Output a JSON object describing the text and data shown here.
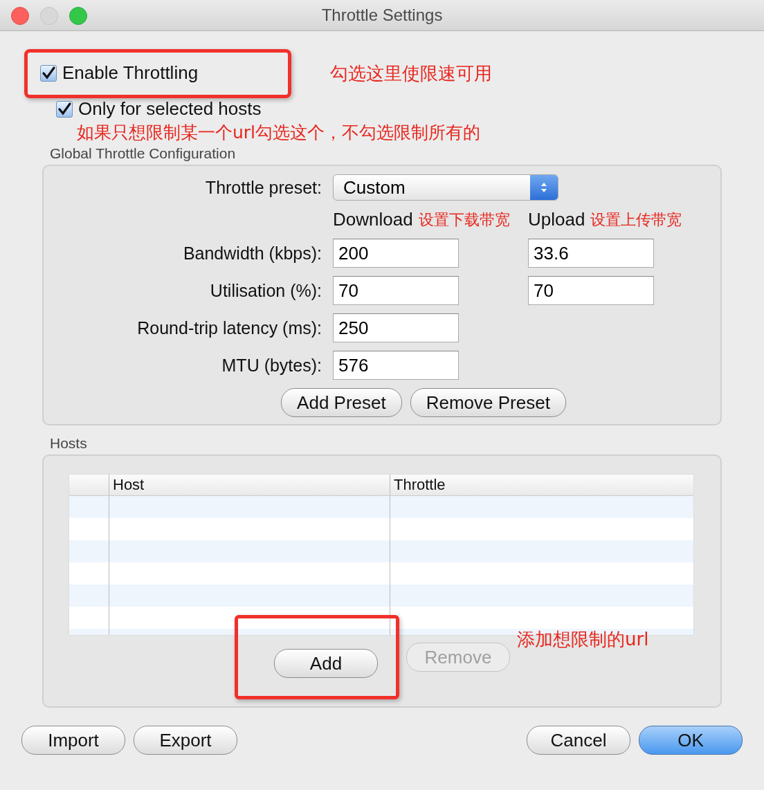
{
  "window": {
    "title": "Throttle Settings"
  },
  "enable_throttling": {
    "label": "Enable Throttling",
    "checked": true,
    "highlighted": true,
    "note": "勾选这里使限速可用"
  },
  "only_selected_hosts": {
    "label": "Only for selected hosts",
    "checked": true,
    "note": "如果只想限制某一个url勾选这个，不勾选限制所有的"
  },
  "global_config": {
    "title": "Global Throttle Configuration",
    "preset": {
      "label": "Throttle preset:",
      "value": "Custom"
    },
    "column_headers": [
      {
        "label": "Download",
        "note": "设置下载带宽"
      },
      {
        "label": "Upload",
        "note": "设置上传带宽"
      }
    ],
    "rows": [
      {
        "label": "Bandwidth (kbps):",
        "download": "200",
        "upload": "33.6"
      },
      {
        "label": "Utilisation (%):",
        "download": "70",
        "upload": "70"
      },
      {
        "label": "Round-trip latency (ms):",
        "download": "250"
      },
      {
        "label": "MTU (bytes):",
        "download": "576"
      }
    ],
    "buttons": [
      {
        "label": "Add Preset",
        "disabled": false
      },
      {
        "label": "Remove Preset",
        "disabled": false
      }
    ]
  },
  "hosts": {
    "title": "Hosts",
    "table": {
      "columns": [
        "Host",
        "Throttle"
      ]
    },
    "buttons": [
      {
        "label": "Add",
        "disabled": false,
        "highlighted": true
      },
      {
        "label": "Remove",
        "disabled": true,
        "highlighted": false
      }
    ],
    "note": "添加想限制的url"
  },
  "footer_buttons": [
    {
      "label": "Import",
      "default": false
    },
    {
      "label": "Export",
      "default": false
    },
    {
      "label": "Cancel",
      "default": false
    },
    {
      "label": "OK",
      "default": true
    }
  ]
}
